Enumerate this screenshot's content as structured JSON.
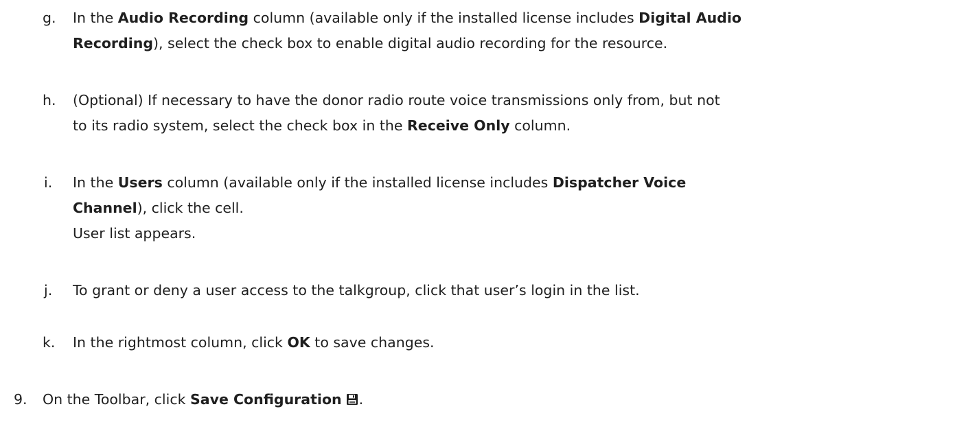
{
  "substeps": [
    {
      "marker": "g.",
      "parts": [
        "In the ",
        "Audio Recording",
        " column (available only if the installed license includes ",
        "Digital Audio",
        "Recording",
        "), select the check box to enable digital audio recording for the resource."
      ]
    },
    {
      "marker": "h.",
      "parts": [
        "(Optional) If necessary to have the donor radio route voice transmissions only from, but not",
        "to its radio system, select the check box in the ",
        "Receive Only",
        " column."
      ]
    },
    {
      "marker": "i.",
      "parts": [
        "In the ",
        "Users",
        " column (available only if the installed license includes ",
        "Dispatcher Voice",
        "Channel",
        "), click the cell.",
        "User list appears."
      ]
    },
    {
      "marker": "j.",
      "parts": [
        "To grant or deny a user access to the talkgroup, click that user’s login in the list."
      ]
    },
    {
      "marker": "k.",
      "parts": [
        "In the rightmost column, click ",
        "OK",
        " to save changes."
      ]
    }
  ],
  "step9": {
    "marker": "9.",
    "parts": [
      "On the Toolbar, click ",
      "Save Configuration",
      "."
    ],
    "icon": "save-icon"
  }
}
